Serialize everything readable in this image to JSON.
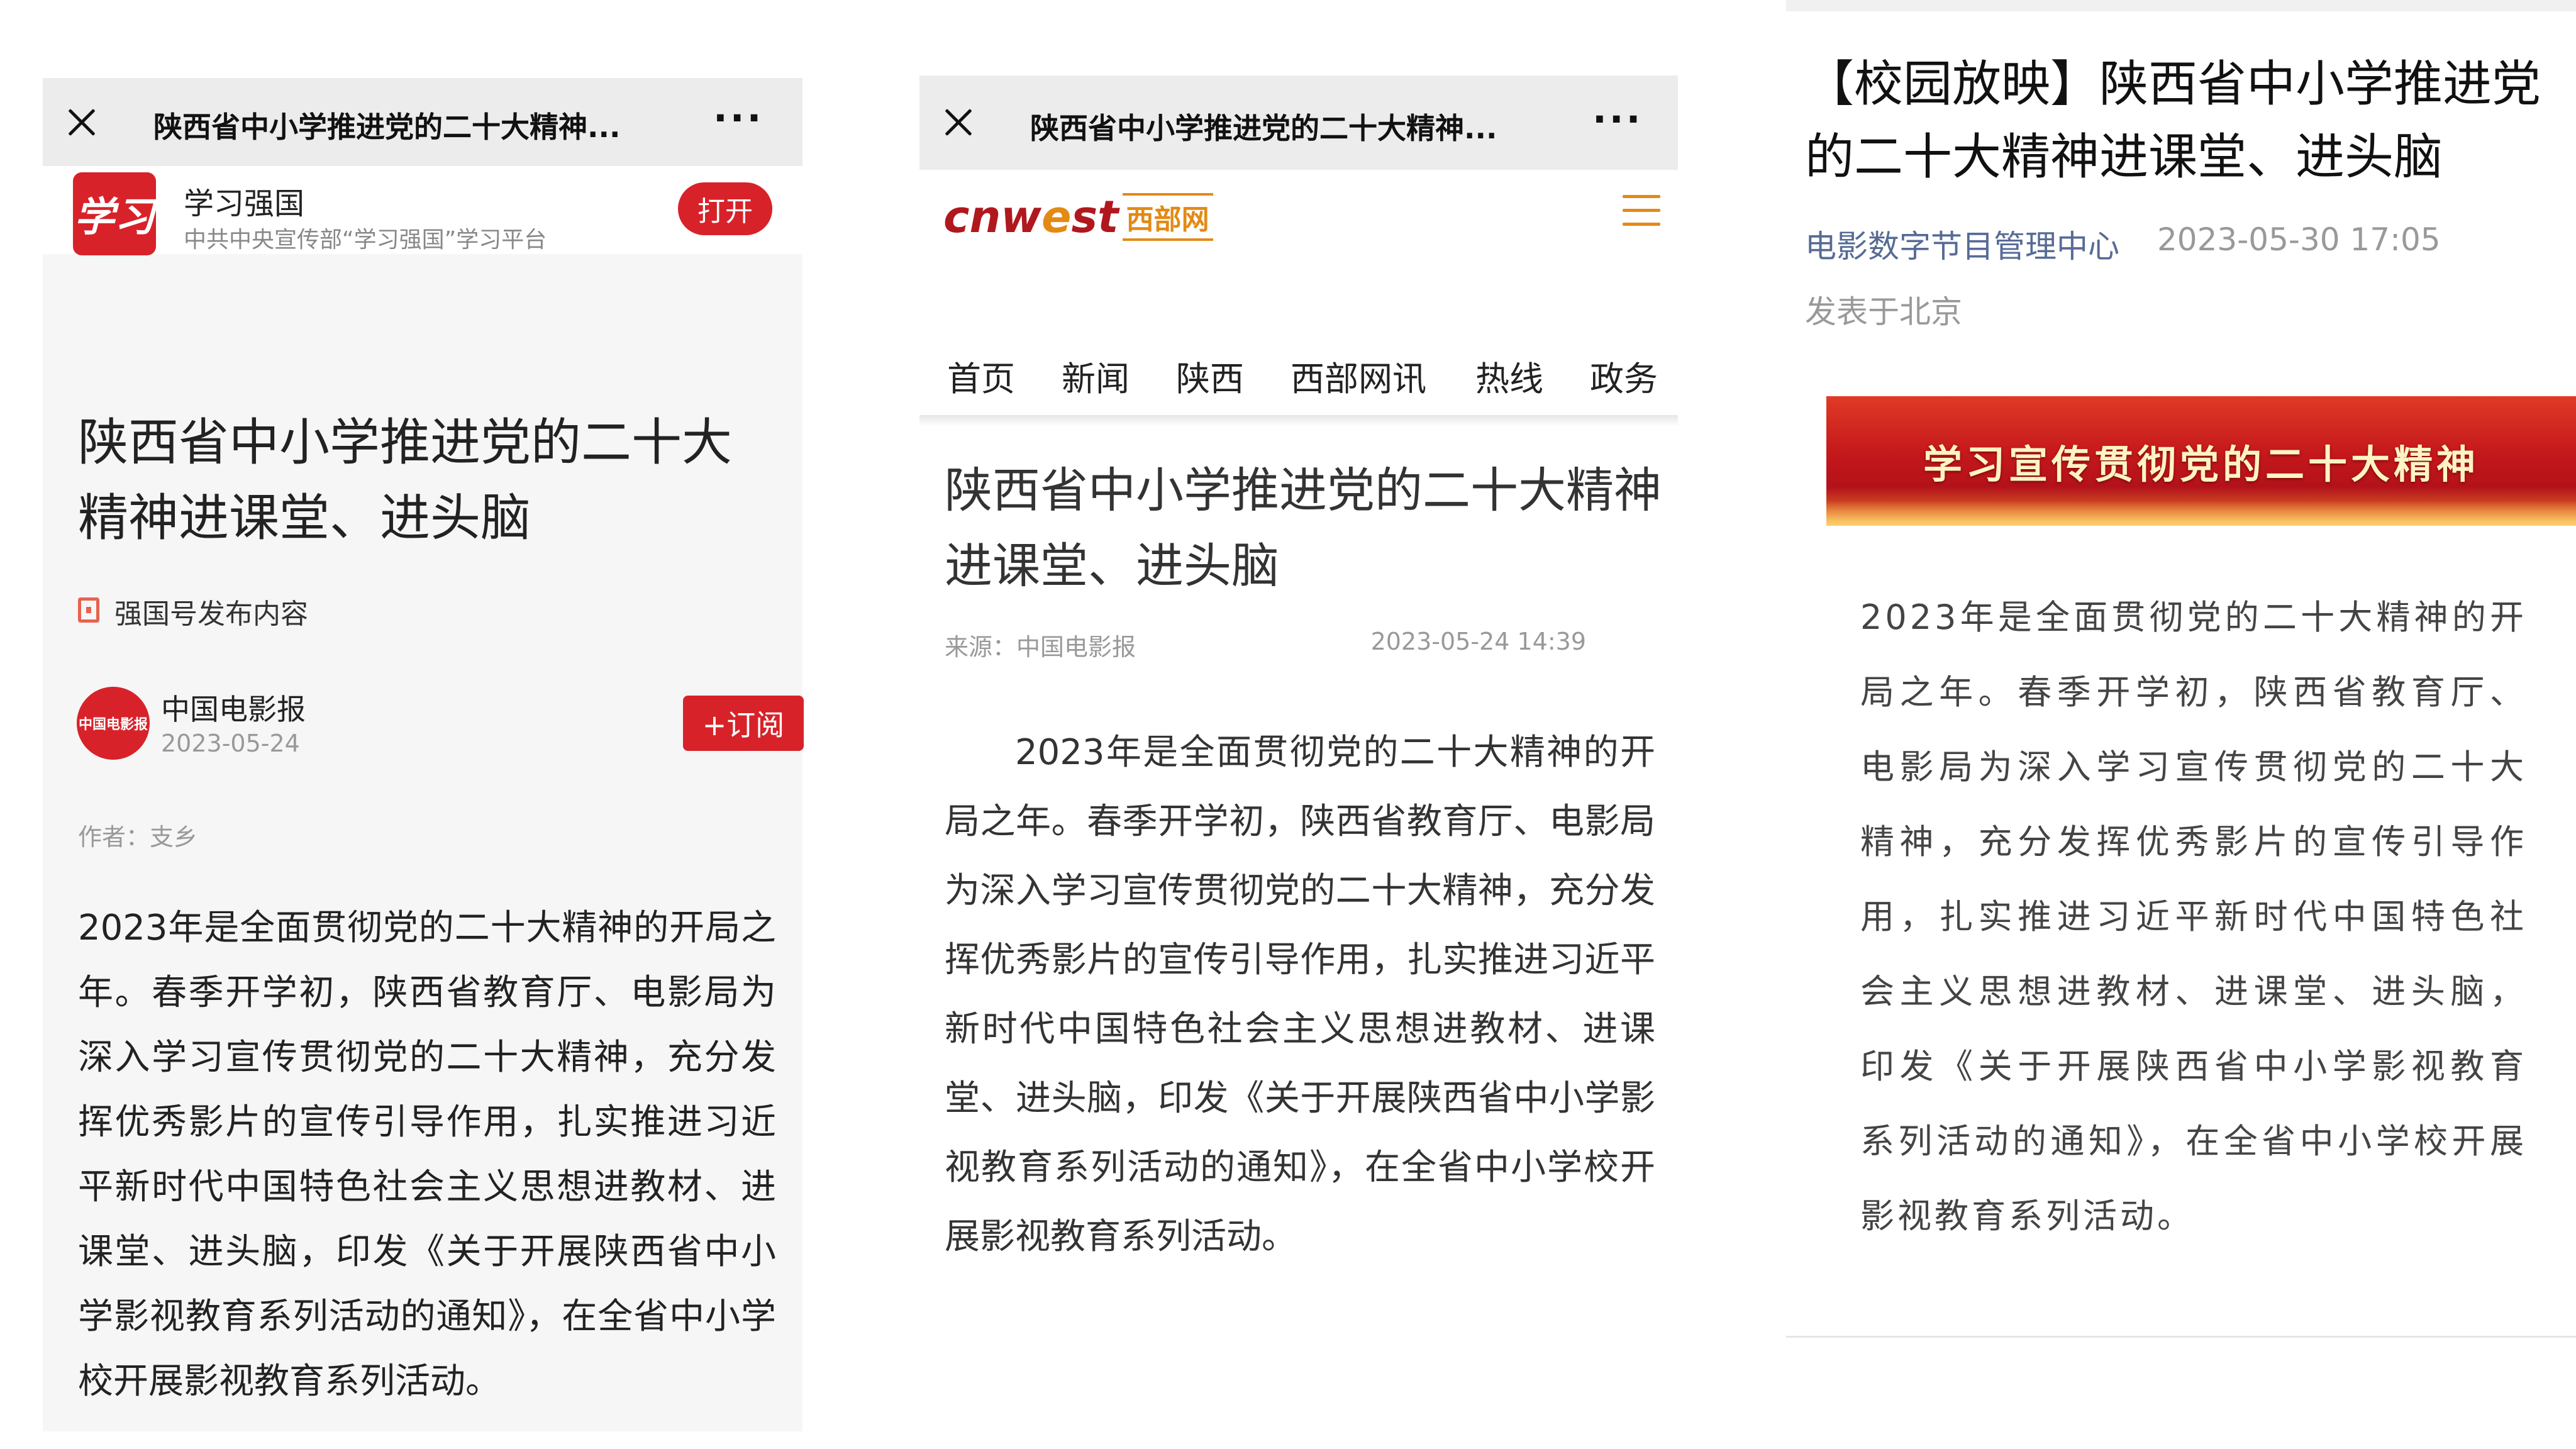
{
  "panel1": {
    "bar_title": "陕西省中小学推进党的二十大精神...",
    "app": {
      "logo_text": "学习",
      "name": "学习强国",
      "subtitle": "中共中央宣传部“学习强国”学习平台",
      "open_label": "打开"
    },
    "title": "陕西省中小学推进党的二十大精神进课堂、进头脑",
    "tag": "强国号发布内容",
    "publisher": {
      "avatar_text": "中国电影报",
      "name": "中国电影报",
      "date": "2023-05-24",
      "subscribe_label": "+订阅"
    },
    "author": "作者：支乡",
    "body": "2023年是全面贯彻党的二十大精神的开局之年。春季开学初，陕西省教育厅、电影局为深入学习宣传贯彻党的二十大精神，充分发挥优秀影片的宣传引导作用，扎实推进习近平新时代中国特色社会主义思想进教材、进课堂、进头脑，印发《关于开展陕西省中小学影视教育系列活动的通知》，在全省中小学校开展影视教育系列活动。"
  },
  "panel2": {
    "bar_title": "陕西省中小学推进党的二十大精神...",
    "logo": {
      "text_a": "cnw",
      "text_e": "e",
      "text_b": "st",
      "badge": "西部网"
    },
    "nav": [
      "首页",
      "新闻",
      "陕西",
      "西部网讯",
      "热线",
      "政务"
    ],
    "title": "陕西省中小学推进党的二十大精神进课堂、进头脑",
    "source": "来源：中国电影报",
    "date": "2023-05-24 14:39",
    "body": "2023年是全面贯彻党的二十大精神的开局之年。春季开学初，陕西省教育厅、电影局为深入学习宣传贯彻党的二十大精神，充分发挥优秀影片的宣传引导作用，扎实推进习近平新时代中国特色社会主义思想进教材、进课堂、进头脑，印发《关于开展陕西省中小学影视教育系列活动的通知》，在全省中小学校开展影视教育系列活动。"
  },
  "panel3": {
    "title": "【校园放映】陕西省中小学推进党的二十大精神进课堂、进头脑",
    "account": "电影数字节目管理中心",
    "datetime": "2023-05-30 17:05",
    "location": "发表于北京",
    "banner_text": "学习宣传贯彻党的二十大精神",
    "body": "2023年是全面贯彻党的二十大精神的开局之年。春季开学初，陕西省教育厅、电影局为深入学习宣传贯彻党的二十大精神，充分发挥优秀影片的宣传引导作用，扎实推进习近平新时代中国特色社会主义思想进教材、进课堂、进头脑，印发《关于开展陕西省中小学影视教育系列活动的通知》，在全省中小学校开展影视教育系列活动。"
  },
  "colors": {
    "red": "#d8222a",
    "link_blue": "#576b95",
    "orange": "#e38a15"
  },
  "icons": [
    "close-icon",
    "more-icon",
    "tag-icon",
    "menu-icon"
  ]
}
